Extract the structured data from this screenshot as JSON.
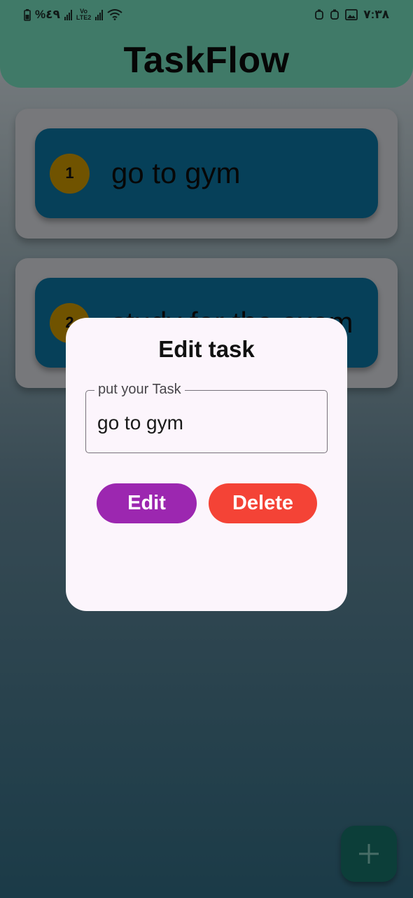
{
  "status_bar": {
    "battery": "%٤٩",
    "network": "LTE2",
    "time": "٧:٣٨"
  },
  "app_bar": {
    "title": "TaskFlow",
    "color": "#6ed3b3"
  },
  "tasks": [
    {
      "number": "1",
      "text": "go to gym"
    },
    {
      "number": "2",
      "text": "study for the exam"
    }
  ],
  "dialog": {
    "title": "Edit task",
    "field": {
      "label": "put your Task",
      "value": "go to gym"
    },
    "edit_label": "Edit",
    "delete_label": "Delete"
  },
  "colors": {
    "task_item": "#0b6f99",
    "number_badge": "#c28f00",
    "edit_button": "#9c27b0",
    "delete_button": "#f44336",
    "fab": "#156b62"
  },
  "icons": {
    "fab": "plus-icon",
    "status": [
      "battery-icon",
      "signal-icon",
      "wifi-icon",
      "notification-icon",
      "gallery-icon"
    ]
  }
}
